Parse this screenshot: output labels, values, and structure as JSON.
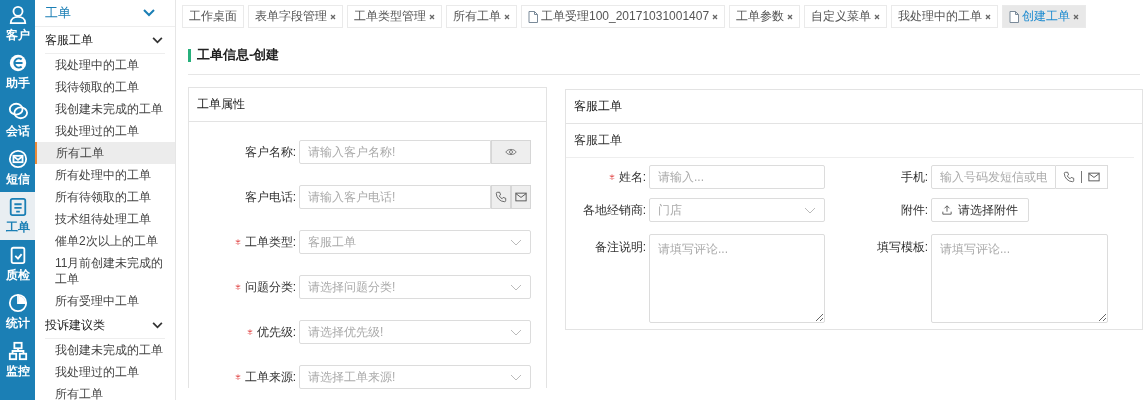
{
  "nav": [
    {
      "label": "客户",
      "selected": false
    },
    {
      "label": "助手",
      "selected": false
    },
    {
      "label": "会话",
      "selected": false
    },
    {
      "label": "短信",
      "selected": false
    },
    {
      "label": "工单",
      "selected": true
    },
    {
      "label": "质检",
      "selected": false
    },
    {
      "label": "统计",
      "selected": false
    },
    {
      "label": "监控",
      "selected": false
    }
  ],
  "sidebar": {
    "title": "工单",
    "expanded": true,
    "groups": [
      {
        "title": "客服工单",
        "expanded": true,
        "items": [
          {
            "label": "我处理中的工单",
            "selected": false
          },
          {
            "label": "我待领取的工单",
            "selected": false
          },
          {
            "label": "我创建未完成的工单",
            "selected": false
          },
          {
            "label": "我处理过的工单",
            "selected": false
          },
          {
            "label": "所有工单",
            "selected": true
          },
          {
            "label": "所有处理中的工单",
            "selected": false
          },
          {
            "label": "所有待领取的工单",
            "selected": false
          },
          {
            "label": "技术组待处理工单",
            "selected": false
          },
          {
            "label": "催单2次以上的工单",
            "selected": false
          },
          {
            "label": "11月前创建未完成的工单",
            "selected": false
          },
          {
            "label": "所有受理中工单",
            "selected": false
          }
        ]
      },
      {
        "title": "投诉建议类",
        "expanded": true,
        "items": [
          {
            "label": "我创建未完成的工单",
            "selected": false
          },
          {
            "label": "我处理过的工单",
            "selected": false
          },
          {
            "label": "所有工单",
            "selected": false
          }
        ]
      }
    ]
  },
  "tabs": [
    {
      "label": "工作桌面",
      "closable": false,
      "document": false,
      "selected": false
    },
    {
      "label": "表单字段管理",
      "closable": true,
      "document": false,
      "selected": false
    },
    {
      "label": "工单类型管理",
      "closable": true,
      "document": false,
      "selected": false
    },
    {
      "label": "所有工单",
      "closable": true,
      "document": false,
      "selected": false
    },
    {
      "label": "工单受理100_20171031001407",
      "closable": true,
      "document": true,
      "selected": false
    },
    {
      "label": "工单参数",
      "closable": true,
      "document": false,
      "selected": false
    },
    {
      "label": "自定义菜单",
      "closable": true,
      "document": false,
      "selected": false
    },
    {
      "label": "我处理中的工单",
      "closable": true,
      "document": false,
      "selected": false
    },
    {
      "label": "创建工单",
      "closable": true,
      "document": true,
      "selected": true
    }
  ],
  "page_title": "工单信息-创建",
  "left_panel": {
    "title": "工单属性",
    "fields": [
      {
        "label": "客户名称:",
        "required": false,
        "kind": "view",
        "placeholder": "请输入客户名称!"
      },
      {
        "label": "客户电话:",
        "required": false,
        "kind": "contact",
        "placeholder": "请输入客户电话!"
      },
      {
        "label": "工单类型:",
        "required": true,
        "kind": "select",
        "placeholder": "客服工单"
      },
      {
        "label": "问题分类:",
        "required": true,
        "kind": "select",
        "placeholder": "请选择问题分类!"
      },
      {
        "label": "优先级:",
        "required": true,
        "kind": "select",
        "placeholder": "请选择优先级!"
      },
      {
        "label": "工单来源:",
        "required": true,
        "kind": "select",
        "placeholder": "请选择工单来源!"
      }
    ]
  },
  "right_panel": {
    "title": "客服工单",
    "subtitle": "客服工单",
    "fields": [
      {
        "label": "姓名:",
        "required": true,
        "kind": "input",
        "placeholder": "请输入..."
      },
      {
        "label": "手机:",
        "required": false,
        "kind": "contact",
        "placeholder": "输入号码发短信或电"
      },
      {
        "label": "各地经销商:",
        "required": false,
        "kind": "select",
        "placeholder": "门店"
      },
      {
        "label": "附件:",
        "required": false,
        "kind": "upload",
        "button_label": "请选择附件"
      },
      {
        "label": "备注说明:",
        "required": false,
        "kind": "textarea",
        "placeholder": "请填写评论..."
      },
      {
        "label": "填写模板:",
        "required": false,
        "kind": "textarea",
        "placeholder": "请填写评论..."
      }
    ]
  }
}
